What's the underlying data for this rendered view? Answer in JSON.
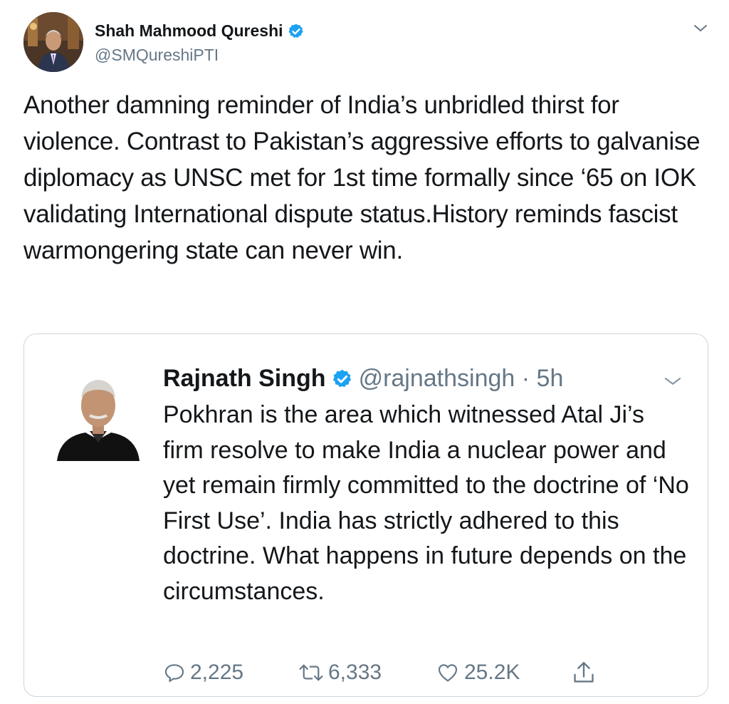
{
  "tweet": {
    "author_name": "Shah Mahmood Qureshi",
    "author_handle": "@SMQureshiPTI",
    "text": "Another damning reminder of India’s unbridled thirst for violence. Contrast to Pakistan’s aggressive efforts to galvanise diplomacy as UNSC met for 1st time formally since ‘65 on IOK validating International dispute status.History reminds fascist warmongering state can never win."
  },
  "quote": {
    "author_name": "Rajnath Singh",
    "meta": "@rajnathsingh · 5h",
    "text": "Pokhran is the area which witnessed Atal Ji’s firm resolve to make India a nuclear power and yet remain firmly committed to the doctrine of ‘No First Use’. India has strictly adhered to this doctrine. What happens in future depends on the circumstances.",
    "replies": "2,225",
    "retweets": "6,333",
    "likes": "25.2K"
  },
  "icons": {
    "verified": "verified-badge-icon",
    "caret": "chevron-down-icon",
    "reply": "reply-icon",
    "retweet": "retweet-icon",
    "like": "heart-icon",
    "share": "share-icon"
  },
  "colors": {
    "verified": "#1da1f2",
    "muted": "#657786",
    "text": "#14171a",
    "border": "#ccd6dd"
  }
}
